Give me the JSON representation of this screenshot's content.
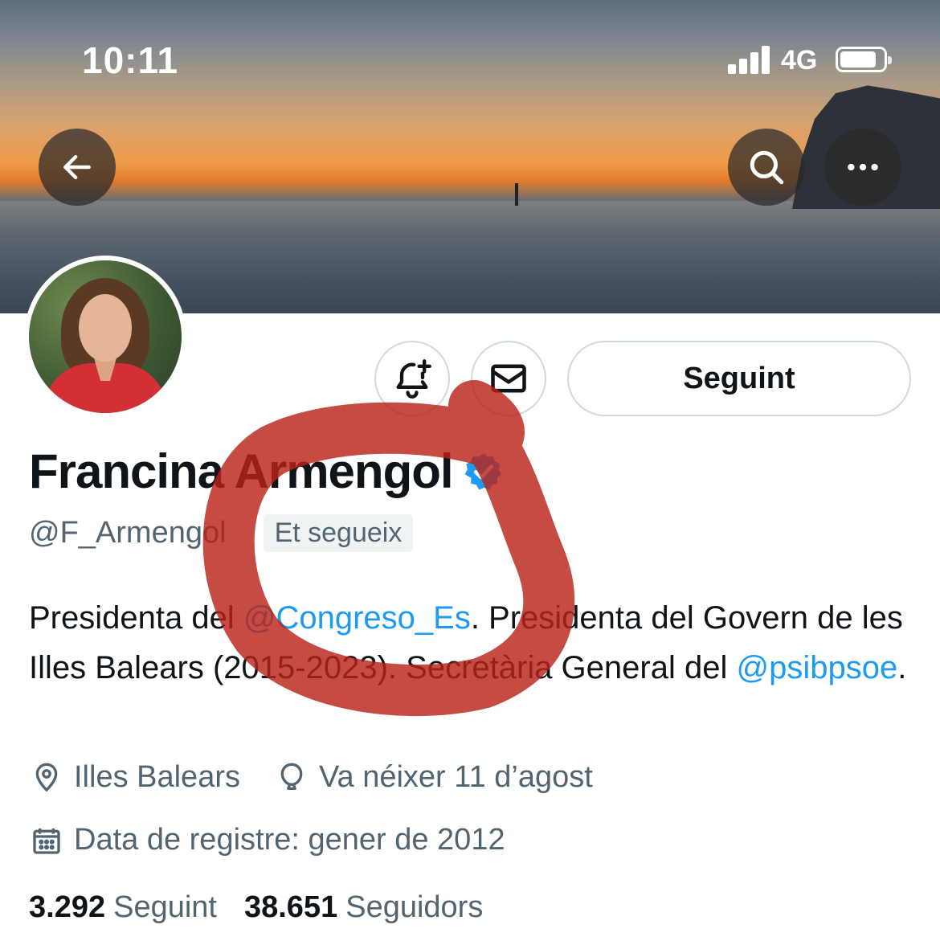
{
  "status_bar": {
    "time": "10:11",
    "network": "4G"
  },
  "header": {
    "back_icon": "arrow-left-icon",
    "search_icon": "search-icon",
    "more_icon": "more-horizontal-icon"
  },
  "profile": {
    "display_name": "Francina Armengol",
    "verified_icon": "verified-badge-icon",
    "handle": "@F_Armengol",
    "follows_you_label": "Et segueix",
    "bio": {
      "part1": "Presidenta del ",
      "mention1": "@Congreso_Es",
      "part2": ". Presidenta del Govern de les Illes Balears (2015-2023). Secretària General del ",
      "mention2": "@psibpsoe",
      "part3": "."
    },
    "location": "Illes Balears",
    "birthday": "Va néixer 11 d’agost",
    "joined": "Data de registre: gener de 2012",
    "following_count": "3.292",
    "following_label": "Seguint",
    "followers_count": "38.651",
    "followers_label": "Seguidors"
  },
  "actions": {
    "notify_icon": "bell-plus-icon",
    "message_icon": "envelope-icon",
    "follow_button_label": "Seguint"
  },
  "colors": {
    "accent": "#1d9bf0",
    "secondary_text": "#536471",
    "annotation": "#b8231a"
  }
}
